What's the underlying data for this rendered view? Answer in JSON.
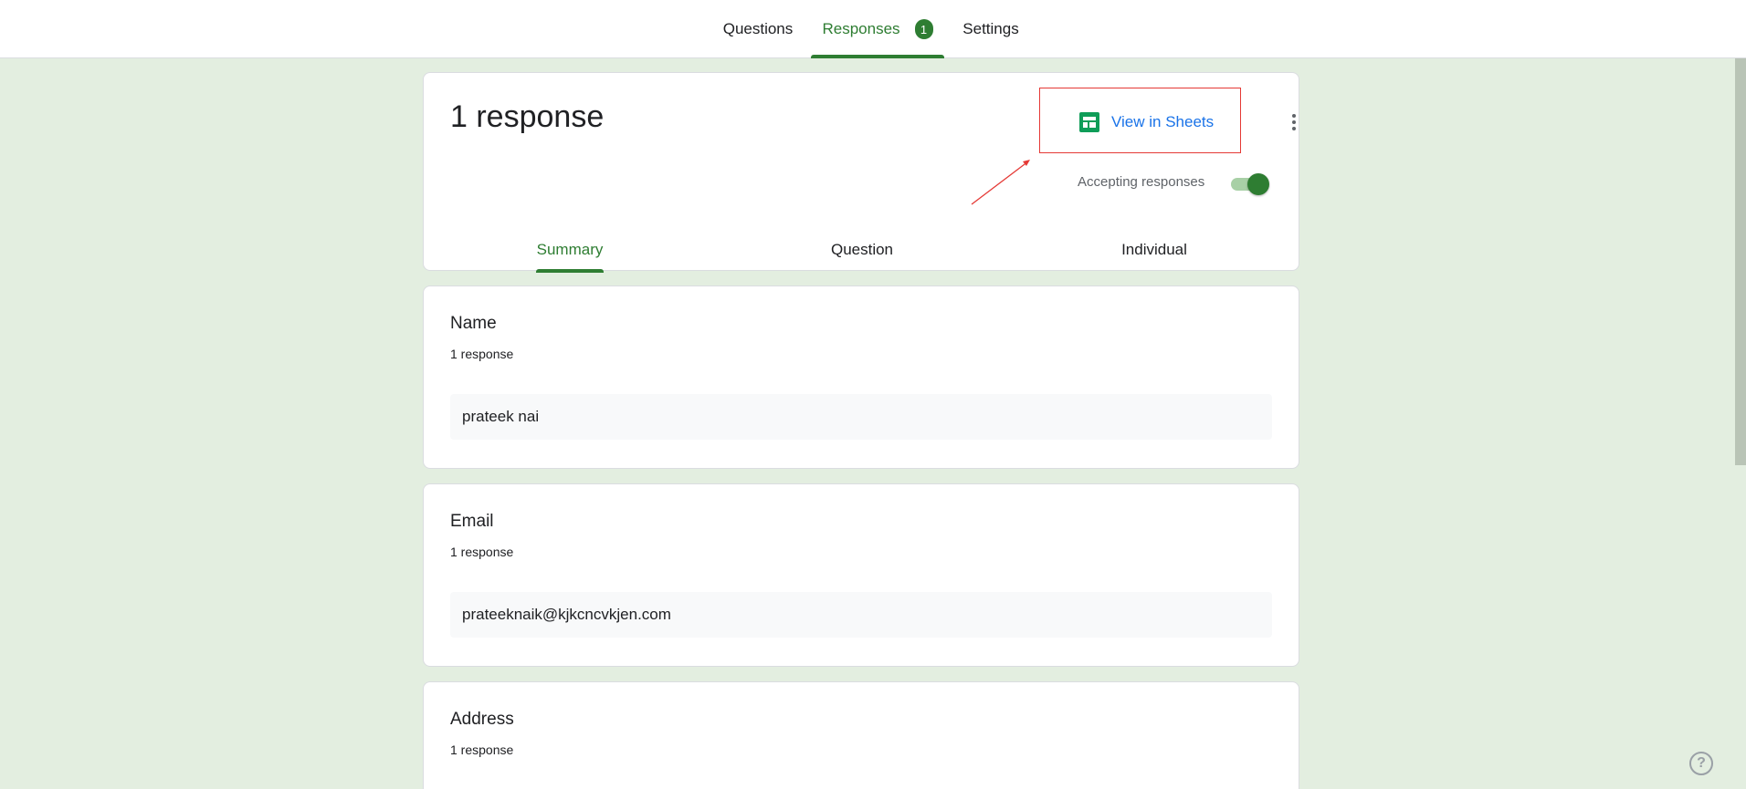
{
  "top_tabs": {
    "questions": "Questions",
    "responses": "Responses",
    "responses_badge": "1",
    "settings": "Settings"
  },
  "header": {
    "title": "1 response",
    "view_in_sheets": "View in Sheets",
    "accepting_label": "Accepting responses",
    "accepting_on": true
  },
  "sub_tabs": {
    "summary": "Summary",
    "question": "Question",
    "individual": "Individual"
  },
  "questions": [
    {
      "title": "Name",
      "count": "1 response",
      "answer": "prateek nai"
    },
    {
      "title": "Email",
      "count": "1 response",
      "answer": "prateeknaik@kjkcncvkjen.com"
    },
    {
      "title": "Address",
      "count": "1 response"
    }
  ],
  "help_icon_glyph": "?",
  "colors": {
    "accent": "#2e7d32",
    "link": "#1a73e8",
    "background": "#e3eee0",
    "annotation": "#e53935"
  }
}
